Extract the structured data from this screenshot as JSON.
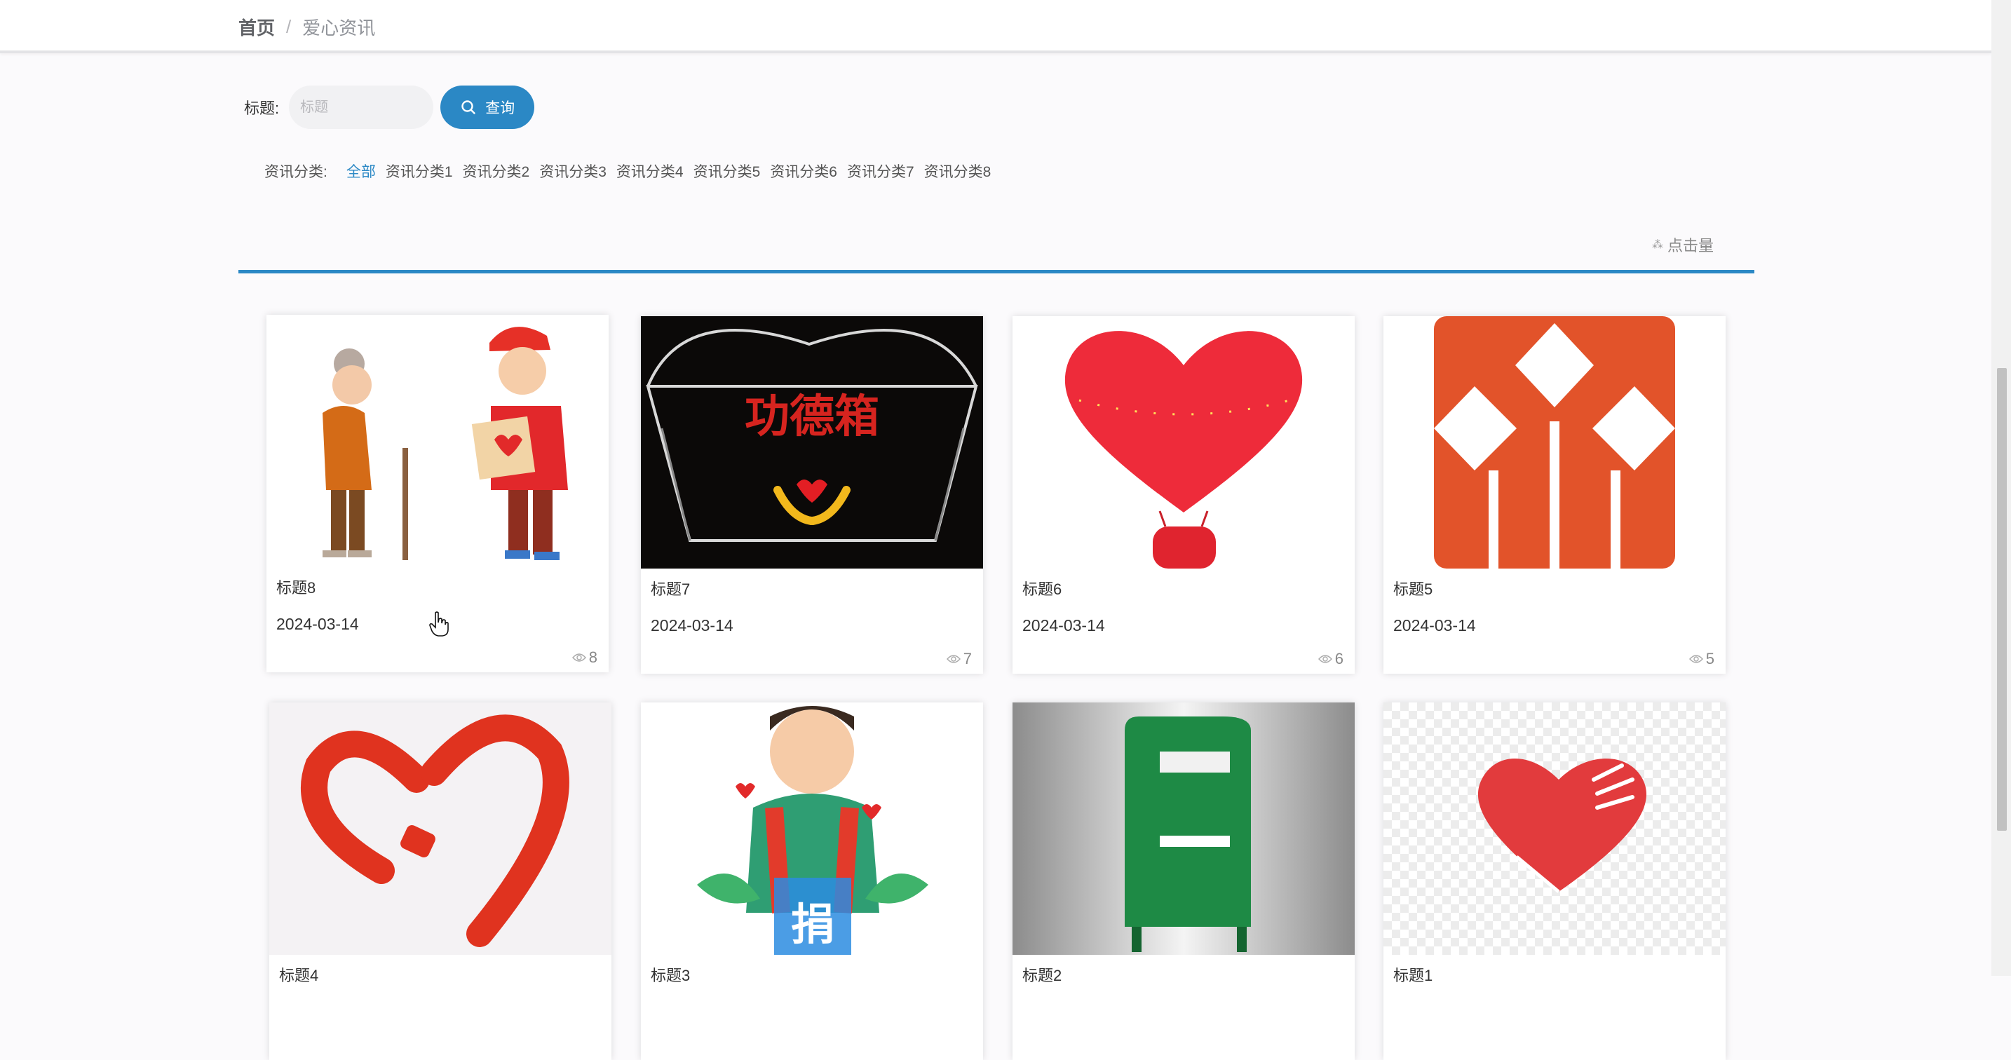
{
  "breadcrumb": {
    "home": "首页",
    "separator": "/",
    "current": "爱心资讯"
  },
  "search": {
    "label": "标题:",
    "placeholder": "标题",
    "value": "",
    "button_label": "查询",
    "button_icon": "search-icon"
  },
  "categories": {
    "label": "资讯分类:",
    "items": [
      "全部",
      "资讯分类1",
      "资讯分类2",
      "资讯分类3",
      "资讯分类4",
      "资讯分类5",
      "资讯分类6",
      "资讯分类7",
      "资讯分类8"
    ],
    "active": "全部"
  },
  "sort": {
    "label": "点击量",
    "icon": "sort-icon"
  },
  "colors": {
    "accent": "#2b88c5",
    "background": "#fbfafc"
  },
  "cards": [
    {
      "title": "标题8",
      "date": "2024-03-14",
      "views": "8",
      "image": "elder-and-volunteer-illustration"
    },
    {
      "title": "标题7",
      "date": "2024-03-14",
      "views": "7",
      "image": "donation-box-photo",
      "image_text": "功德箱"
    },
    {
      "title": "标题6",
      "date": "2024-03-14",
      "views": "6",
      "image": "heart-balloon-illustration"
    },
    {
      "title": "标题5",
      "date": "2024-03-14",
      "views": "5",
      "image": "orange-logo"
    },
    {
      "title": "标题4",
      "date": "",
      "views": "",
      "image": "red-heart-logo"
    },
    {
      "title": "标题3",
      "date": "",
      "views": "",
      "image": "boy-with-donation-box-illustration",
      "image_text": "捐"
    },
    {
      "title": "标题2",
      "date": "",
      "views": "",
      "image": "green-clothing-bin-photo"
    },
    {
      "title": "标题1",
      "date": "",
      "views": "",
      "image": "heart-hand-logo"
    }
  ]
}
